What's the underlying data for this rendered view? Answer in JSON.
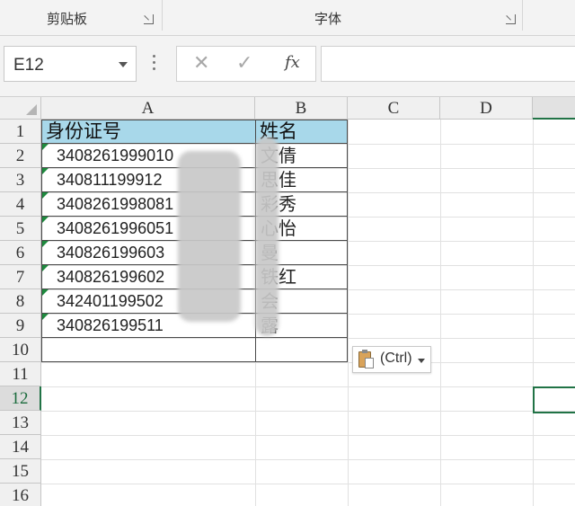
{
  "ribbon": {
    "groups": [
      {
        "label": "剪贴板"
      },
      {
        "label": "字体"
      }
    ]
  },
  "formula_bar": {
    "name_box": "E12",
    "formula_value": ""
  },
  "sheet": {
    "columns": [
      "A",
      "B",
      "C",
      "D"
    ],
    "rows": [
      "1",
      "2",
      "3",
      "4",
      "5",
      "6",
      "7",
      "8",
      "9",
      "10",
      "11",
      "12",
      "13",
      "14",
      "15",
      "16"
    ],
    "header": {
      "a": "身份证号",
      "b": "姓名"
    },
    "records": [
      {
        "id": "3408261999010",
        "name": "文倩"
      },
      {
        "id": "340811199912",
        "name": "思佳"
      },
      {
        "id": "3408261998081",
        "name": "彩秀"
      },
      {
        "id": "3408261996051",
        "name": "心怡"
      },
      {
        "id": "340826199603",
        "name": "曼"
      },
      {
        "id": "340826199602",
        "name": "铁红"
      },
      {
        "id": "342401199502",
        "name": "会"
      },
      {
        "id": "340826199511",
        "name": "露"
      }
    ],
    "active_cell": "E12",
    "active_row": "12"
  },
  "paste_options": {
    "label": "(Ctrl)"
  },
  "colors": {
    "header_fill": "#a8d8ea",
    "selection": "#217346",
    "error_marker": "#1e8a3e"
  }
}
